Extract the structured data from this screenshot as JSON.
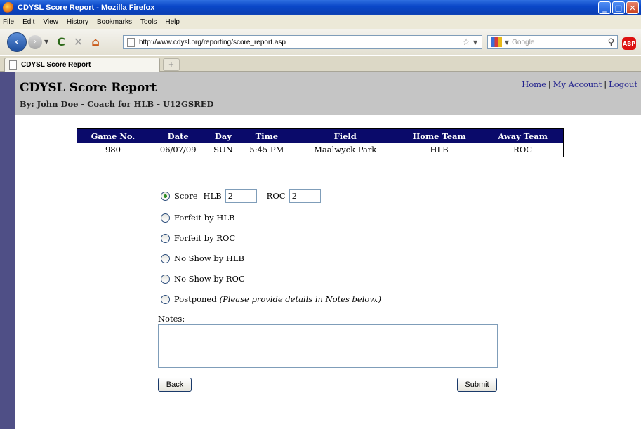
{
  "window": {
    "title": "CDYSL Score Report - Mozilla Firefox"
  },
  "menu": [
    "File",
    "Edit",
    "View",
    "History",
    "Bookmarks",
    "Tools",
    "Help"
  ],
  "nav": {
    "url": "http://www.cdysl.org/reporting/score_report.asp",
    "search_placeholder": "Google",
    "abp": "ABP"
  },
  "tab": {
    "label": "CDYSL Score Report"
  },
  "page": {
    "title": "CDYSL Score Report",
    "subtitle": "By: John Doe - Coach for HLB - U12GSRED",
    "links": {
      "home": "Home",
      "my_account": "My Account",
      "logout": "Logout"
    }
  },
  "game_table": {
    "headers": [
      "Game No.",
      "Date",
      "Day",
      "Time",
      "Field",
      "Home Team",
      "Away Team"
    ],
    "row": [
      "980",
      "06/07/09",
      "SUN",
      "5:45 PM",
      "Maalwyck Park",
      "HLB",
      "ROC"
    ]
  },
  "form": {
    "score_label": "Score",
    "home_label": "HLB",
    "home_score": "2",
    "away_label": "ROC",
    "away_score": "2",
    "forfeit_home": "Forfeit by HLB",
    "forfeit_away": "Forfeit by ROC",
    "noshow_home": "No Show by HLB",
    "noshow_away": "No Show by ROC",
    "postponed": "Postponed",
    "postponed_note": "(Please provide details in Notes below.)",
    "notes_label": "Notes:",
    "notes_value": "",
    "back": "Back",
    "submit": "Submit"
  }
}
